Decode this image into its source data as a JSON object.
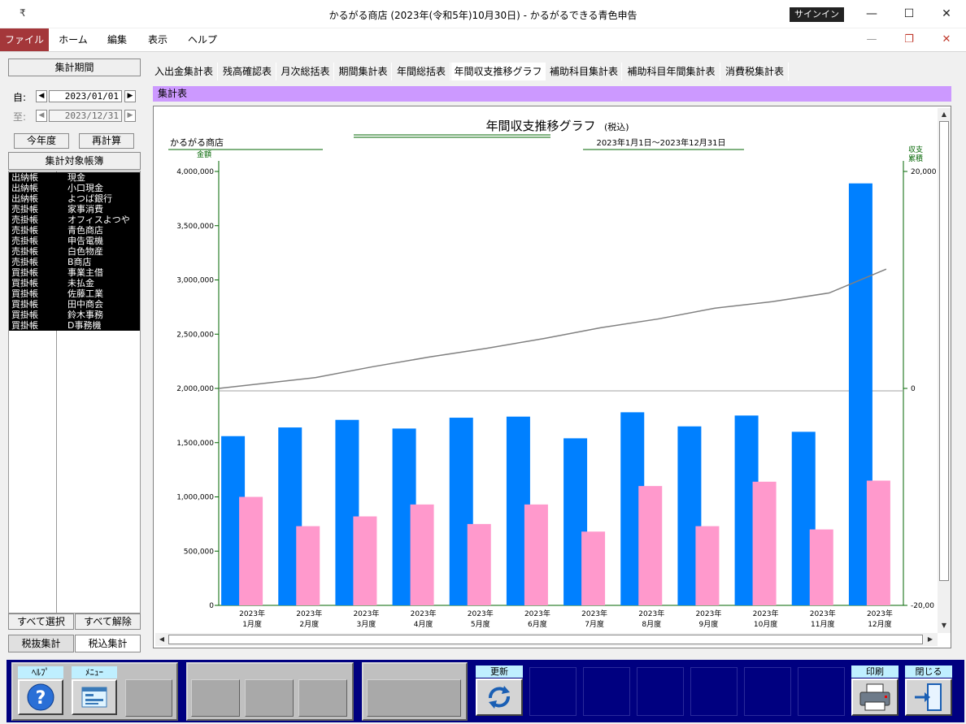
{
  "window": {
    "title": "かるがる商店 (2023年(令和5年)10月30日)  -  かるがるできる青色申告",
    "signin": "サインイン",
    "qat_icon": "₹"
  },
  "ribbon": {
    "tabs": [
      "ファイル",
      "ホーム",
      "編集",
      "表示",
      "ヘルプ"
    ]
  },
  "left": {
    "period_header": "集計期間",
    "from_label": "自:",
    "to_label": "至:",
    "from_date": "2023/01/01",
    "to_date": "2023/12/31",
    "this_year": "今年度",
    "recalc": "再計算",
    "ledger_header": "集計対象帳簿",
    "ledgers": [
      {
        "type": "出納帳",
        "name": "現金"
      },
      {
        "type": "出納帳",
        "name": "小口現金"
      },
      {
        "type": "出納帳",
        "name": "よつば銀行"
      },
      {
        "type": "売掛帳",
        "name": "家事消費"
      },
      {
        "type": "売掛帳",
        "name": "オフィスよつや"
      },
      {
        "type": "売掛帳",
        "name": "青色商店"
      },
      {
        "type": "売掛帳",
        "name": "申告電機"
      },
      {
        "type": "売掛帳",
        "name": "白色物産"
      },
      {
        "type": "売掛帳",
        "name": "B商店"
      },
      {
        "type": "買掛帳",
        "name": "事業主借"
      },
      {
        "type": "買掛帳",
        "name": "未払金"
      },
      {
        "type": "買掛帳",
        "name": "佐藤工業"
      },
      {
        "type": "買掛帳",
        "name": "田中商会"
      },
      {
        "type": "買掛帳",
        "name": "鈴木事務"
      },
      {
        "type": "買掛帳",
        "name": " D事務機"
      }
    ],
    "select_all": "すべて選択",
    "clear_all": "すべて解除",
    "tax_excluded": "税抜集計",
    "tax_included": "税込集計"
  },
  "tabs": [
    "入出金集計表",
    "残高確認表",
    "月次総括表",
    "期間集計表",
    "年間総括表",
    "年間収支推移グラフ",
    "補助科目集計表",
    "補助科目年間集計表",
    "消費税集計表"
  ],
  "active_tab": 5,
  "section_title": "集計表",
  "chart_data": {
    "type": "bar",
    "title": "年間収支推移グラフ",
    "title_suffix": "(税込)",
    "company": "かるがる商店",
    "period": "2023年1月1日～2023年12月31日",
    "ylabel": "金額",
    "y2label_line1": "収支",
    "y2label_line2": "累積",
    "ylim": [
      0,
      4000000
    ],
    "yticks": [
      "4,000,000",
      "3,500,000",
      "3,000,000",
      "2,500,000",
      "2,000,000",
      "1,500,000",
      "1,000,000",
      "500,000",
      "0"
    ],
    "y2lim": [
      -20000,
      20000
    ],
    "y2ticks": [
      "20,000",
      "0",
      "-20,00"
    ],
    "categories": [
      [
        "2023年",
        "1月度"
      ],
      [
        "2023年",
        "2月度"
      ],
      [
        "2023年",
        "3月度"
      ],
      [
        "2023年",
        "4月度"
      ],
      [
        "2023年",
        "5月度"
      ],
      [
        "2023年",
        "6月度"
      ],
      [
        "2023年",
        "7月度"
      ],
      [
        "2023年",
        "8月度"
      ],
      [
        "2023年",
        "9月度"
      ],
      [
        "2023年",
        "10月度"
      ],
      [
        "2023年",
        "11月度"
      ],
      [
        "2023年",
        "12月度"
      ]
    ],
    "series": [
      {
        "color": "#0080ff",
        "values": [
          1560000,
          1640000,
          1710000,
          1630000,
          1730000,
          1740000,
          1540000,
          1780000,
          1650000,
          1750000,
          1600000,
          3890000
        ]
      },
      {
        "color": "#ff99cc",
        "values": [
          1000000,
          730000,
          820000,
          930000,
          750000,
          930000,
          680000,
          1100000,
          730000,
          1140000,
          700000,
          1150000
        ]
      },
      {
        "type": "line",
        "axis": "y2",
        "color": "#808080",
        "values": [
          0,
          1000,
          2000,
          2900,
          3700,
          4600,
          5600,
          6400,
          7400,
          8000,
          8800,
          11000
        ]
      }
    ],
    "grid": false
  },
  "toolbar": {
    "help": "ﾍﾙﾌﾟ",
    "menu": "ﾒﾆｭｰ",
    "refresh": "更新",
    "print": "印刷",
    "close": "閉じる"
  }
}
